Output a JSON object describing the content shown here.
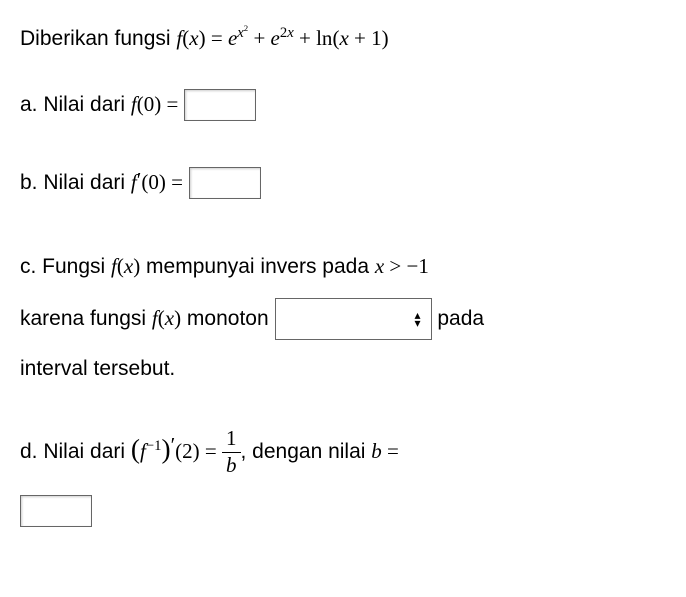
{
  "intro": {
    "prefix": "Diberikan fungsi ",
    "fx_label": "f",
    "open": "(",
    "x": "x",
    "close": ")",
    "eq": " = ",
    "e1": "e",
    "e1_exp_base": "x",
    "e1_exp_pow": "2",
    "plus1": " + ",
    "e2": "e",
    "e2_exp": "2x",
    "plus2": " + ",
    "ln": "ln",
    "ln_open": "(",
    "ln_x": "x",
    "ln_plus": " + ",
    "ln_one": "1",
    "ln_close": ")"
  },
  "a": {
    "label": "a. Nilai dari ",
    "f": "f",
    "open": "(",
    "zero": "0",
    "close": ")",
    "eq": " ="
  },
  "b": {
    "label": "b. Nilai dari ",
    "f": "f",
    "prime": "′",
    "open": "(",
    "zero": "0",
    "close": ")",
    "eq": " ="
  },
  "c": {
    "line1_prefix": "c. Fungsi ",
    "f": "f",
    "open": "(",
    "x": "x",
    "close": ")",
    "line1_mid": " mempunyai invers pada ",
    "x2": "x",
    "gt": " > ",
    "neg": "−",
    "one": "1",
    "line2_prefix": "karena fungsi ",
    "line2_mid": " monoton ",
    "line2_suffix": " pada",
    "line3": "interval tersebut."
  },
  "d": {
    "label": "d. Nilai dari ",
    "open_big": "(",
    "f": "f",
    "exp_neg": "−1",
    "close_big": ")",
    "prime": "′",
    "open": "(",
    "two": "2",
    "close": ")",
    "eq": " = ",
    "num": "1",
    "den": "b",
    "comma": ", ",
    "suffix": "dengan nilai ",
    "b": "b",
    "eq2": " ="
  }
}
